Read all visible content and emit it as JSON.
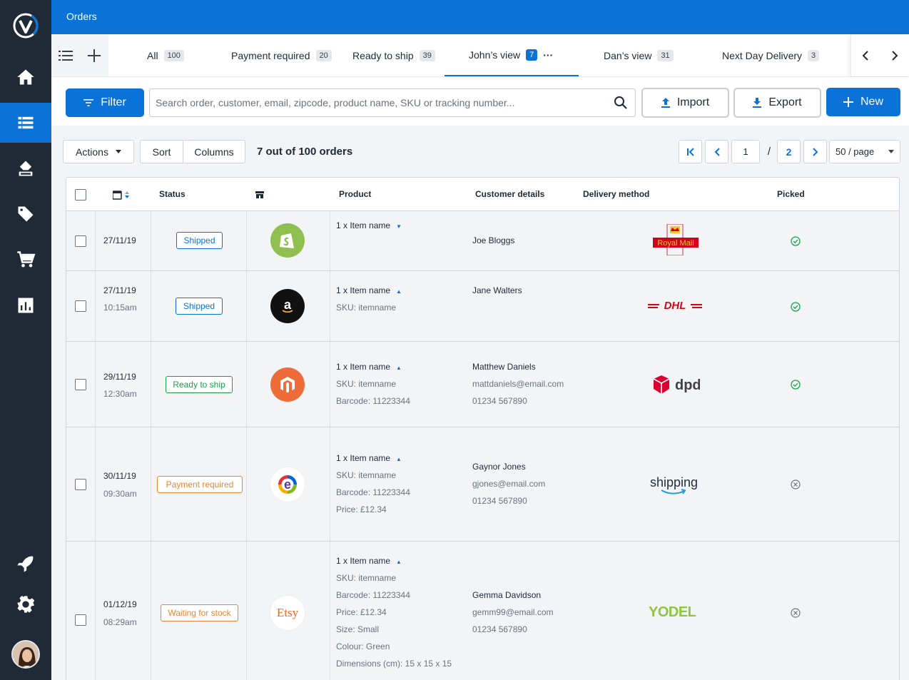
{
  "app": {
    "section_title": "Orders"
  },
  "tabs": [
    {
      "label": "All",
      "count": "100"
    },
    {
      "label": "Payment required",
      "count": "20"
    },
    {
      "label": "Ready to ship",
      "count": "39"
    },
    {
      "label": "John’s view",
      "count": "7",
      "more": "···"
    },
    {
      "label": "Dan’s view",
      "count": "31"
    },
    {
      "label": "Next Day Delivery",
      "count": "3"
    }
  ],
  "toolbar": {
    "filter_label": "Filter",
    "search_placeholder": "Search order, customer, email, zipcode, product name, SKU or tracking number...",
    "import_label": "Import",
    "export_label": "Export",
    "new_label": "New"
  },
  "actions_bar": {
    "actions_label": "Actions",
    "sort_label": "Sort",
    "columns_label": "Columns",
    "result_count": "7 out of 100 orders",
    "current_page": "1",
    "page_separator": "/",
    "total_pages": "2",
    "per_page": "50 / page"
  },
  "table": {
    "headers": {
      "status": "Status",
      "product": "Product",
      "customer": "Customer details",
      "delivery": "Delivery method",
      "picked": "Picked"
    },
    "rows": [
      {
        "date": "27/11/19",
        "time": "",
        "status": "Shipped",
        "status_color": "#0b73d8",
        "store": "shopify-icon",
        "product_lines": [
          "1 x Item name"
        ],
        "caret": "▼",
        "customer_lines": [
          "Joe Bloggs"
        ],
        "carrier": "Royal Mail",
        "picked": "check-circle-icon"
      },
      {
        "date": "27/11/19",
        "time": "10:15am",
        "status": "Shipped",
        "status_color": "#0b73d8",
        "store": "amazon-icon",
        "product_lines": [
          "1 x Item name",
          "SKU: itemname"
        ],
        "caret": "▲",
        "customer_lines": [
          "Jane Walters"
        ],
        "carrier": "DHL",
        "picked": "check-circle-icon"
      },
      {
        "date": "29/11/19",
        "time": "12:30am",
        "status": "Ready to ship",
        "status_color": "#16a34a",
        "store": "magento-icon",
        "product_lines": [
          "1 x Item name",
          "SKU: itemname",
          "Barcode: 11223344"
        ],
        "caret": "▲",
        "customer_lines": [
          "Matthew Daniels",
          "mattdaniels@email.com",
          "01234 567890"
        ],
        "carrier": "dpd",
        "picked": "check-circle-icon"
      },
      {
        "date": "30/11/19",
        "time": "09:30am",
        "status": "Payment required",
        "status_color": "#f0842c",
        "store": "ebay-icon",
        "product_lines": [
          "1 x Item name",
          "SKU: itemname",
          "Barcode: 11223344",
          "Price: £12.34"
        ],
        "caret": "▲",
        "customer_lines": [
          "Gaynor Jones",
          "gjones@email.com",
          "01234 567890"
        ],
        "carrier": "shipping",
        "picked": "x-circle-icon"
      },
      {
        "date": "01/12/19",
        "time": "08:29am",
        "status": "Waiting for stock",
        "status_color": "#f0842c",
        "store": "Etsy",
        "product_lines": [
          "1 x Item name",
          "SKU: itemname",
          "Barcode: 11223344",
          "Price: £12.34",
          "Size: Small",
          "Colour: Green",
          "Dimensions (cm): 15 x 15 x 15"
        ],
        "caret": "▲",
        "customer_lines": [
          "Gemma Davidson",
          "gemm99@email.com",
          "01234 567890"
        ],
        "carrier": "YODEL",
        "picked": "x-circle-icon"
      }
    ]
  }
}
